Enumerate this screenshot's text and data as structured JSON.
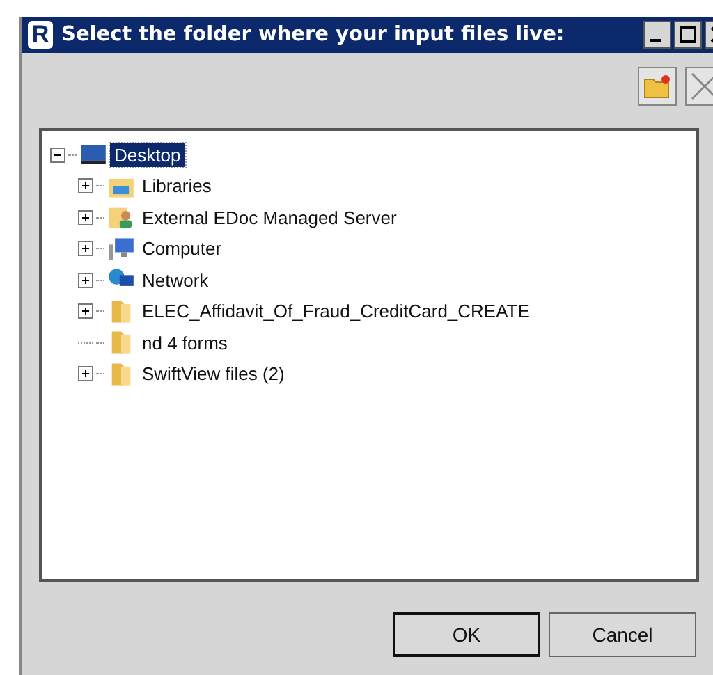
{
  "window": {
    "logo": "R",
    "title": "Select the folder where your input files live:"
  },
  "tree": [
    {
      "label": "Desktop",
      "kind": "desktop",
      "selected": true,
      "expanded": true,
      "expandable": true,
      "children": [
        {
          "label": "Libraries",
          "kind": "libraries",
          "selected": false,
          "expandable": true
        },
        {
          "label": "External EDoc Managed Server",
          "kind": "user",
          "selected": false,
          "expandable": true
        },
        {
          "label": "Computer",
          "kind": "computer",
          "selected": false,
          "expandable": true
        },
        {
          "label": "Network",
          "kind": "network",
          "selected": false,
          "expandable": true
        },
        {
          "label": "ELEC_Affidavit_Of_Fraud_CreditCard_CREATE",
          "kind": "folder",
          "selected": false,
          "expandable": true
        },
        {
          "label": "nd 4 forms",
          "kind": "folder",
          "selected": false,
          "expandable": false
        },
        {
          "label": "SwiftView files (2)",
          "kind": "folder",
          "selected": false,
          "expandable": true
        }
      ]
    }
  ],
  "buttons": [
    {
      "label": "OK",
      "default": true
    },
    {
      "label": "Cancel",
      "default": false
    }
  ]
}
